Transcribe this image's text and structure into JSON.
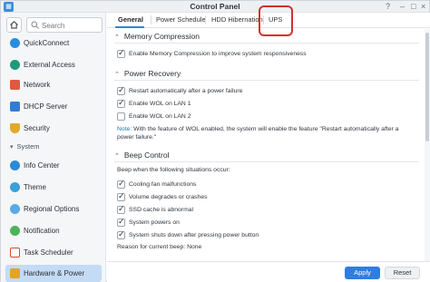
{
  "window": {
    "title": "Control Panel"
  },
  "sidebar": {
    "search_placeholder": "Search",
    "items_top": [
      {
        "label": "QuickConnect",
        "icon": "quickconnect-icon",
        "color": "#2c8de0"
      },
      {
        "label": "External Access",
        "icon": "globe-icon",
        "color": "#1e9a7a"
      },
      {
        "label": "Network",
        "icon": "network-icon",
        "color": "#e05a3c"
      },
      {
        "label": "DHCP Server",
        "icon": "dhcp-icon",
        "color": "#2f7dd6"
      },
      {
        "label": "Security",
        "icon": "shield-icon",
        "color": "#e1a92c"
      }
    ],
    "section_system": "System",
    "items_system": [
      {
        "label": "Info Center",
        "icon": "info-icon",
        "color": "#2a8ad8"
      },
      {
        "label": "Theme",
        "icon": "theme-icon",
        "color": "#3aa0d9"
      },
      {
        "label": "Regional Options",
        "icon": "regional-icon",
        "color": "#5aa9e6"
      },
      {
        "label": "Notification",
        "icon": "notification-icon",
        "color": "#4db35a"
      },
      {
        "label": "Task Scheduler",
        "icon": "calendar-icon",
        "color": "#d9453a"
      },
      {
        "label": "Hardware & Power",
        "icon": "power-icon",
        "color": "#e8a125"
      }
    ]
  },
  "tabs": [
    {
      "label": "General"
    },
    {
      "label": "Power Schedule"
    },
    {
      "label": "HDD Hibernation"
    },
    {
      "label": "UPS"
    }
  ],
  "sections": {
    "memory": {
      "title": "Memory Compression",
      "option": "Enable Memory Compression to improve system responsiveness"
    },
    "power_recovery": {
      "title": "Power Recovery",
      "options": [
        {
          "label": "Restart automatically after a power failure",
          "checked": true
        },
        {
          "label": "Enable WOL on LAN 1",
          "checked": true
        },
        {
          "label": "Enable WOL on LAN 2",
          "checked": false
        }
      ],
      "note_label": "Note:",
      "note_text": "With the feature of WOL enabled, the system will enable the feature \"Restart automatically after a power failure.\""
    },
    "beep": {
      "title": "Beep Control",
      "intro": "Beep when the following situations occur:",
      "options": [
        {
          "label": "Cooling fan malfunctions",
          "checked": true
        },
        {
          "label": "Volume degrades or crashes",
          "checked": true
        },
        {
          "label": "SSD cache is abnormal",
          "checked": true
        },
        {
          "label": "System powers on",
          "checked": true
        },
        {
          "label": "System shuts down after pressing power button",
          "checked": true
        }
      ],
      "reason": "Reason for current beep: None"
    }
  },
  "buttons": {
    "apply": "Apply",
    "reset": "Reset"
  },
  "colors": {
    "accent": "#2f7de1",
    "highlight_ring": "#d62f2f",
    "active_nav": "#c3dbf5"
  }
}
